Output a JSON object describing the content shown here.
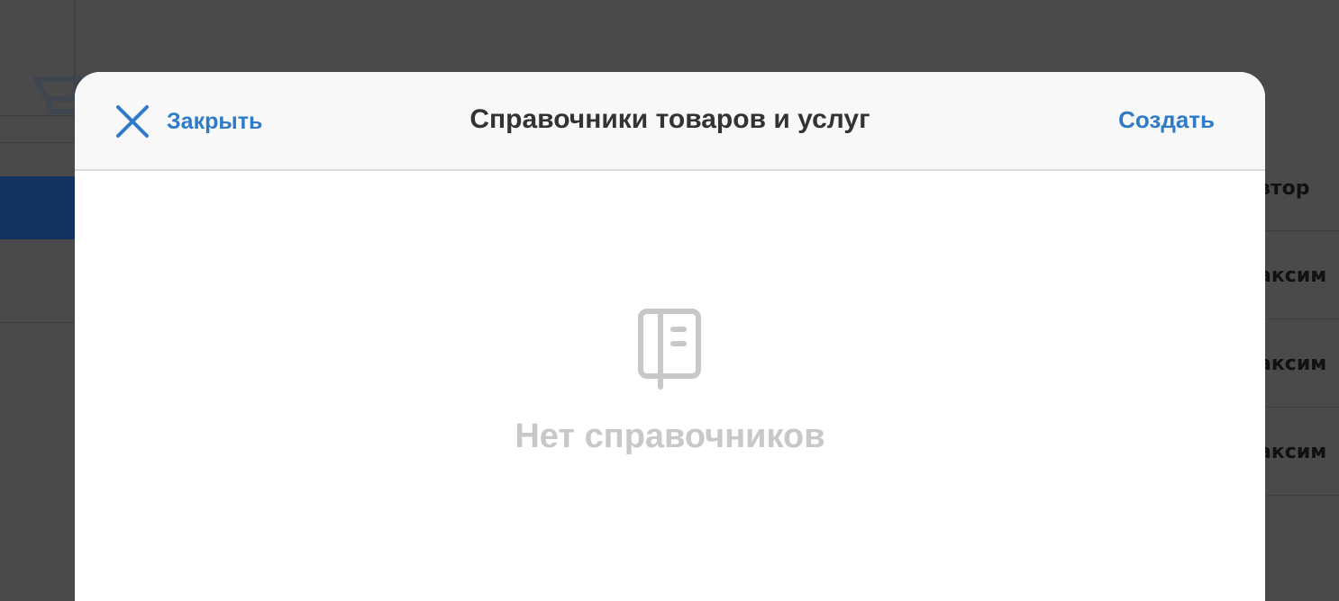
{
  "background": {
    "table_header_partial": "втор",
    "rows_partial": [
      "аксим",
      "аксим",
      "аксим"
    ]
  },
  "modal": {
    "close_label": "Закрыть",
    "title": "Справочники товаров и услуг",
    "create_label": "Создать",
    "empty_text": "Нет справочников"
  },
  "icons": {
    "close": "close-icon",
    "empty": "notebook-icon",
    "background": "cart-icon"
  },
  "colors": {
    "accent": "#2f7ac9",
    "title": "#333333",
    "empty_text": "#c8c8c8",
    "overlay": "#4a4a4a",
    "active_nav": "#143260"
  }
}
